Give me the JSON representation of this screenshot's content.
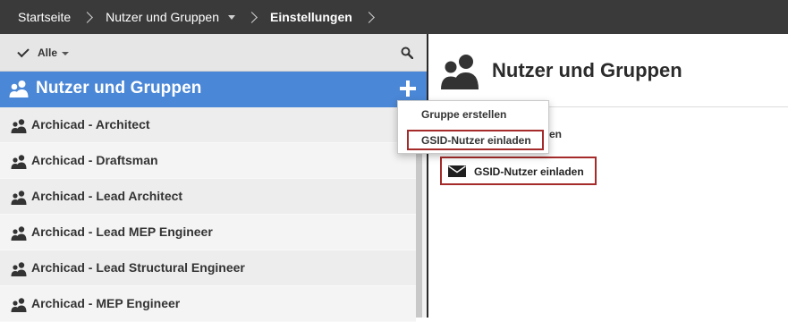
{
  "breadcrumb": {
    "items": [
      "Startseite",
      "Nutzer und Gruppen",
      "Einstellungen"
    ]
  },
  "filter": {
    "label": "Alle"
  },
  "groups_panel": {
    "title": "Nutzer und Gruppen",
    "items": [
      "Archicad - Architect",
      "Archicad - Draftsman",
      "Archicad - Lead Architect",
      "Archicad - Lead MEP Engineer",
      "Archicad - Lead Structural Engineer",
      "Archicad - MEP Engineer"
    ]
  },
  "add_menu": {
    "items": [
      "Gruppe erstellen",
      "GSID-Nutzer einladen"
    ]
  },
  "detail": {
    "title": "Nutzer und Gruppen",
    "partial_text": "en",
    "invite_button": "GSID-Nutzer einladen"
  },
  "colors": {
    "topbar": "#3a3a3a",
    "accent": "#4a87d6",
    "highlight_border": "#a52a2a"
  },
  "icons": {
    "group": "users-icon",
    "search": "search-icon",
    "add": "plus-icon",
    "filter": "check-icon",
    "invite": "mail-icon"
  }
}
